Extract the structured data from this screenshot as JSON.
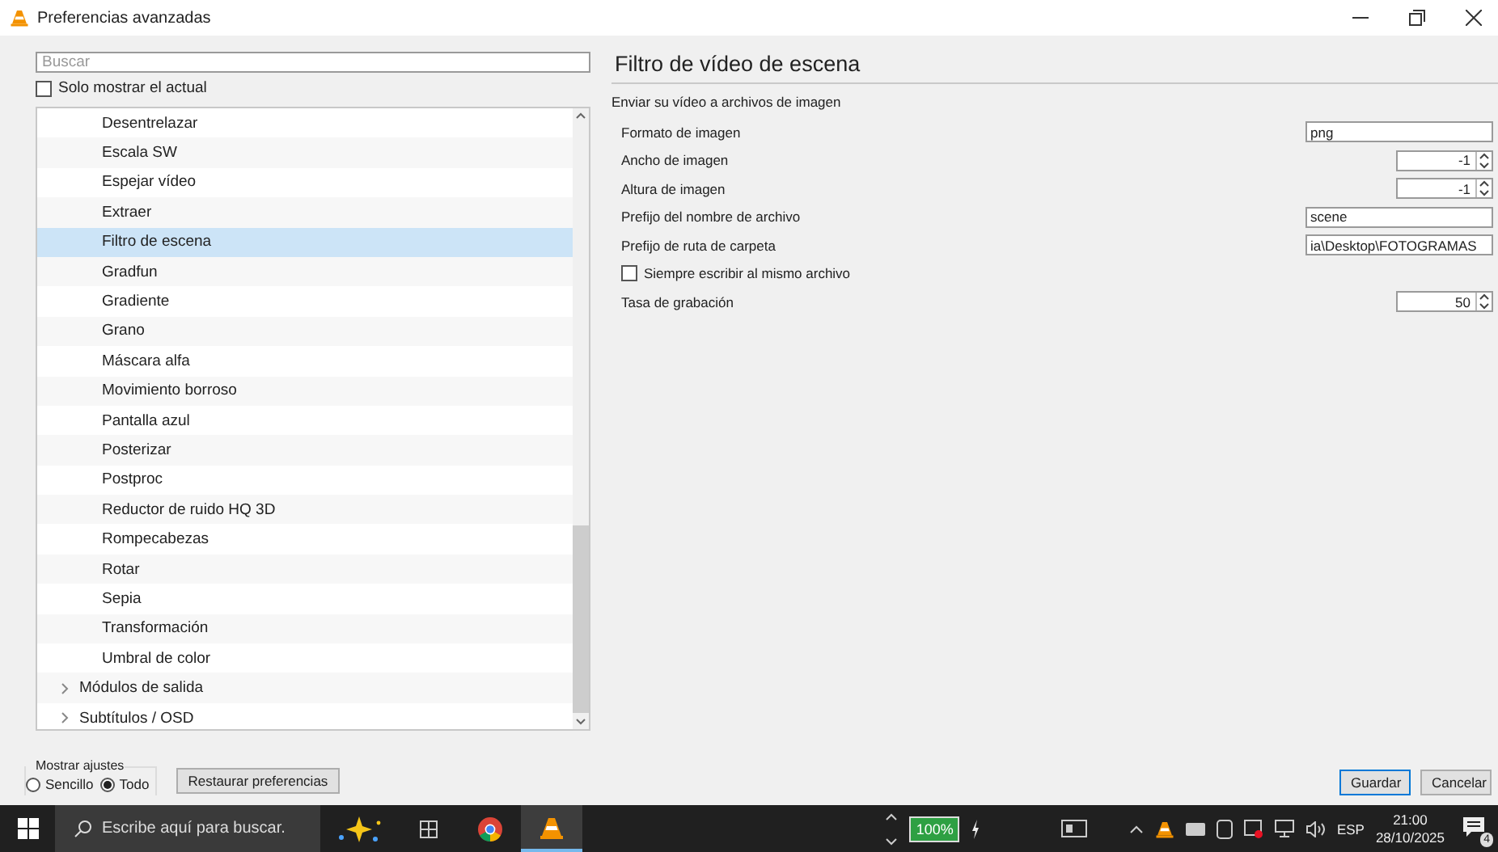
{
  "window": {
    "title": "Preferencias avanzadas"
  },
  "search": {
    "placeholder": "Buscar"
  },
  "only_current": {
    "label": "Solo mostrar el actual",
    "checked": false
  },
  "tree": {
    "items": [
      {
        "label": "Desentrelazar",
        "selected": false
      },
      {
        "label": "Escala SW",
        "selected": false
      },
      {
        "label": "Espejar vídeo",
        "selected": false
      },
      {
        "label": "Extraer",
        "selected": false
      },
      {
        "label": "Filtro de escena",
        "selected": true
      },
      {
        "label": "Gradfun",
        "selected": false
      },
      {
        "label": "Gradiente",
        "selected": false
      },
      {
        "label": "Grano",
        "selected": false
      },
      {
        "label": "Máscara alfa",
        "selected": false
      },
      {
        "label": "Movimiento borroso",
        "selected": false
      },
      {
        "label": "Pantalla azul",
        "selected": false
      },
      {
        "label": "Posterizar",
        "selected": false
      },
      {
        "label": "Postproc",
        "selected": false
      },
      {
        "label": "Reductor de ruido HQ 3D",
        "selected": false
      },
      {
        "label": "Rompecabezas",
        "selected": false
      },
      {
        "label": "Rotar",
        "selected": false
      },
      {
        "label": "Sepia",
        "selected": false
      },
      {
        "label": "Transformación",
        "selected": false
      },
      {
        "label": "Umbral de color",
        "selected": false
      }
    ],
    "groups": [
      {
        "label": "Módulos de salida",
        "expanded": false,
        "selected": false
      },
      {
        "label": "Subtítulos / OSD",
        "expanded": false,
        "selected": false
      }
    ]
  },
  "panel": {
    "title": "Filtro de vídeo de escena",
    "description": "Enviar su vídeo a archivos de imagen",
    "settings": [
      {
        "kind": "text",
        "label": "Formato de imagen",
        "value": "png"
      },
      {
        "kind": "spin",
        "label": "Ancho de imagen",
        "value": "-1"
      },
      {
        "kind": "spin",
        "label": "Altura de imagen",
        "value": "-1"
      },
      {
        "kind": "text",
        "label": "Prefijo del nombre de archivo",
        "value": "scene"
      },
      {
        "kind": "text",
        "label": "Prefijo de ruta de carpeta",
        "value": "ia\\Desktop\\FOTOGRAMAS"
      },
      {
        "kind": "checkbox",
        "label": "Siempre escribir al mismo archivo",
        "checked": false
      },
      {
        "kind": "spin",
        "label": "Tasa de grabación",
        "value": "50"
      }
    ]
  },
  "show_settings": {
    "title": "Mostrar ajustes",
    "options": [
      {
        "label": "Sencillo",
        "selected": false
      },
      {
        "label": "Todo",
        "selected": true
      }
    ]
  },
  "buttons": {
    "reset": "Restaurar preferencias",
    "save": "Guardar",
    "cancel": "Cancelar"
  },
  "taskbar": {
    "search_placeholder": "Escribe aquí para buscar.",
    "battery": "100%",
    "language": "ESP",
    "time": "21:00",
    "date": "28/10/2025",
    "notifications": "4"
  }
}
